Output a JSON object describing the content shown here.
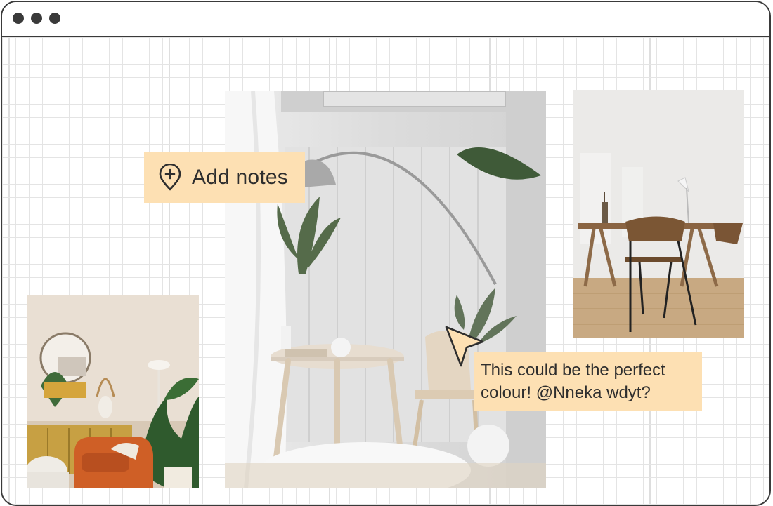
{
  "window": {
    "controls": [
      "close",
      "minimize",
      "maximize"
    ]
  },
  "notes": {
    "add_label": "Add notes",
    "add_icon": "map-pin-plus-icon"
  },
  "comment": {
    "text": "This could be the perfect colour! @Nneka wdyt?"
  },
  "photos": [
    {
      "name": "living-room-photo",
      "subject": "living room with orange armchair and plants"
    },
    {
      "name": "dining-nook-photo",
      "subject": "white dining nook with arc floor lamp and plants"
    },
    {
      "name": "desk-photo",
      "subject": "wooden desk with chair and lamp"
    }
  ],
  "colors": {
    "note_bg": "#fde0b3",
    "frame": "#3a3a3a",
    "grid": "#e4e4e4"
  }
}
